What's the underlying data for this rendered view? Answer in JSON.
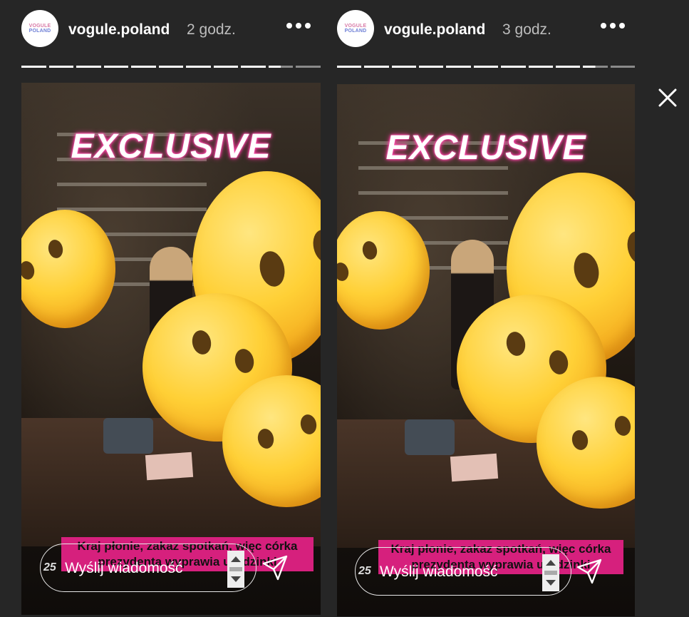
{
  "stories": [
    {
      "avatar_line1": "VOGULE",
      "avatar_line2": "POLAND",
      "username": "vogule.poland",
      "time_ago": "2 godz.",
      "sticker_text": "EXCLUSIVE",
      "caption_line1": "Kraj płonie, zakaz spotkań, więc córka",
      "caption_line2": "prezydenta wyprawia urodzinki",
      "message_count": "25",
      "message_placeholder": "Wyślij wiadomość",
      "progress_total": 11,
      "progress_done": 9.5
    },
    {
      "avatar_line1": "VOGULE",
      "avatar_line2": "POLAND",
      "username": "vogule.poland",
      "time_ago": "3 godz.",
      "sticker_text": "EXCLUSIVE",
      "caption_line1": "Kraj płonie, zakaz spotkań, więc córka",
      "caption_line2": "prezydenta wyprawia urodzinki",
      "message_count": "25",
      "message_placeholder": "Wyślij wiadomość",
      "progress_total": 11,
      "progress_done": 9.5
    }
  ],
  "icons": {
    "more": "more-dots-icon",
    "send": "send-paper-plane-icon",
    "close": "close-x-icon",
    "emoji": "emoji-face-without-mouth"
  },
  "colors": {
    "background": "#262626",
    "caption_bg": "#d6207d",
    "neon_glow": "#ff2f9a"
  }
}
